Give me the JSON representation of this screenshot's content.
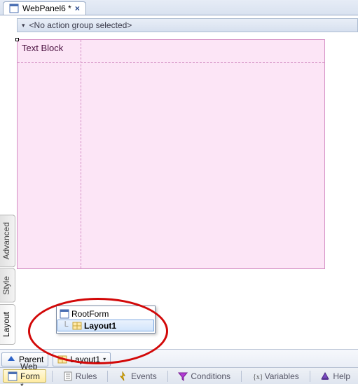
{
  "tab": {
    "label": "WebPanel6 *"
  },
  "actionbar": {
    "text": "<No action group selected>"
  },
  "canvas": {
    "textblock_label": "Text Block"
  },
  "tree": {
    "root_label": "RootForm",
    "child_label": "Layout1"
  },
  "parent": {
    "button_label": "Parent",
    "combo_value": "Layout1"
  },
  "sidetabs": {
    "layout": "Layout",
    "style": "Style",
    "advanced": "Advanced"
  },
  "bottom": {
    "webform": "Web Form *",
    "rules": "Rules",
    "events": "Events",
    "conditions": "Conditions",
    "variables": "Variables",
    "help": "Help"
  }
}
